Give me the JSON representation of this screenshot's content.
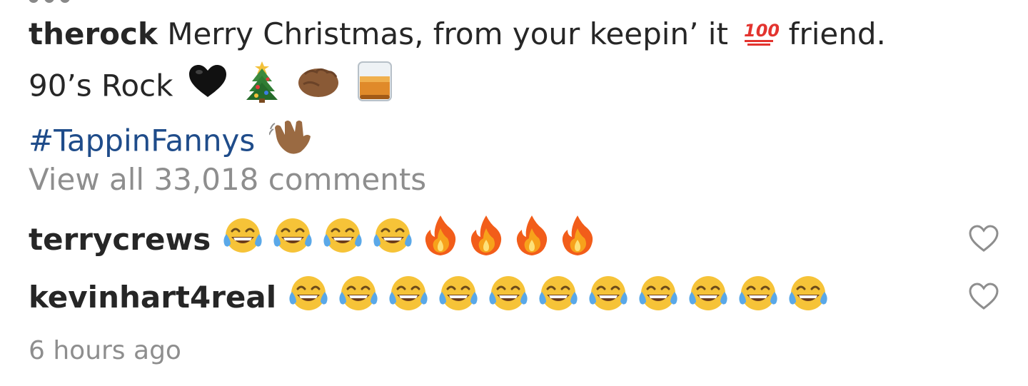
{
  "post": {
    "author": "therock",
    "caption_line1": "Merry Christmas, from your keepin’ it",
    "caption_line1_after": "friend.",
    "caption_line2": "90’s Rock",
    "hashtag": "#TappinFannys",
    "view_all": "View all 33,018 comments",
    "timestamp": "6 hours ago"
  },
  "comments": [
    {
      "username": "terrycrews",
      "emojis": [
        "joy",
        "joy",
        "joy",
        "joy",
        "fire",
        "fire",
        "fire",
        "fire"
      ]
    },
    {
      "username": "kevinhart4real",
      "emojis": [
        "joy",
        "joy",
        "joy",
        "joy",
        "joy",
        "joy",
        "joy",
        "joy",
        "joy",
        "joy",
        "joy"
      ]
    }
  ],
  "icons": {
    "hundred": "hundred-points-icon",
    "black_heart": "black-heart-icon",
    "christmas_tree": "christmas-tree-icon",
    "fist": "oncoming-fist-icon",
    "whisky": "tumbler-glass-icon",
    "wave": "waving-hand-icon",
    "like": "heart-outline-icon"
  },
  "colors": {
    "text": "#262626",
    "muted": "#8e8e8e",
    "hashtag": "#1f4c8a"
  }
}
